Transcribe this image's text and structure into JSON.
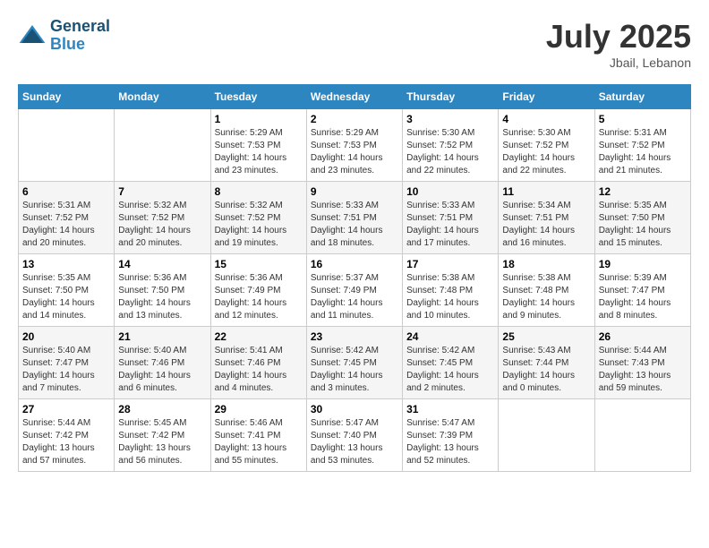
{
  "header": {
    "logo_general": "General",
    "logo_blue": "Blue",
    "month_year": "July 2025",
    "location": "Jbail, Lebanon"
  },
  "weekdays": [
    "Sunday",
    "Monday",
    "Tuesday",
    "Wednesday",
    "Thursday",
    "Friday",
    "Saturday"
  ],
  "weeks": [
    [
      {
        "day": "",
        "sunrise": "",
        "sunset": "",
        "daylight": ""
      },
      {
        "day": "",
        "sunrise": "",
        "sunset": "",
        "daylight": ""
      },
      {
        "day": "1",
        "sunrise": "Sunrise: 5:29 AM",
        "sunset": "Sunset: 7:53 PM",
        "daylight": "Daylight: 14 hours and 23 minutes."
      },
      {
        "day": "2",
        "sunrise": "Sunrise: 5:29 AM",
        "sunset": "Sunset: 7:53 PM",
        "daylight": "Daylight: 14 hours and 23 minutes."
      },
      {
        "day": "3",
        "sunrise": "Sunrise: 5:30 AM",
        "sunset": "Sunset: 7:52 PM",
        "daylight": "Daylight: 14 hours and 22 minutes."
      },
      {
        "day": "4",
        "sunrise": "Sunrise: 5:30 AM",
        "sunset": "Sunset: 7:52 PM",
        "daylight": "Daylight: 14 hours and 22 minutes."
      },
      {
        "day": "5",
        "sunrise": "Sunrise: 5:31 AM",
        "sunset": "Sunset: 7:52 PM",
        "daylight": "Daylight: 14 hours and 21 minutes."
      }
    ],
    [
      {
        "day": "6",
        "sunrise": "Sunrise: 5:31 AM",
        "sunset": "Sunset: 7:52 PM",
        "daylight": "Daylight: 14 hours and 20 minutes."
      },
      {
        "day": "7",
        "sunrise": "Sunrise: 5:32 AM",
        "sunset": "Sunset: 7:52 PM",
        "daylight": "Daylight: 14 hours and 20 minutes."
      },
      {
        "day": "8",
        "sunrise": "Sunrise: 5:32 AM",
        "sunset": "Sunset: 7:52 PM",
        "daylight": "Daylight: 14 hours and 19 minutes."
      },
      {
        "day": "9",
        "sunrise": "Sunrise: 5:33 AM",
        "sunset": "Sunset: 7:51 PM",
        "daylight": "Daylight: 14 hours and 18 minutes."
      },
      {
        "day": "10",
        "sunrise": "Sunrise: 5:33 AM",
        "sunset": "Sunset: 7:51 PM",
        "daylight": "Daylight: 14 hours and 17 minutes."
      },
      {
        "day": "11",
        "sunrise": "Sunrise: 5:34 AM",
        "sunset": "Sunset: 7:51 PM",
        "daylight": "Daylight: 14 hours and 16 minutes."
      },
      {
        "day": "12",
        "sunrise": "Sunrise: 5:35 AM",
        "sunset": "Sunset: 7:50 PM",
        "daylight": "Daylight: 14 hours and 15 minutes."
      }
    ],
    [
      {
        "day": "13",
        "sunrise": "Sunrise: 5:35 AM",
        "sunset": "Sunset: 7:50 PM",
        "daylight": "Daylight: 14 hours and 14 minutes."
      },
      {
        "day": "14",
        "sunrise": "Sunrise: 5:36 AM",
        "sunset": "Sunset: 7:50 PM",
        "daylight": "Daylight: 14 hours and 13 minutes."
      },
      {
        "day": "15",
        "sunrise": "Sunrise: 5:36 AM",
        "sunset": "Sunset: 7:49 PM",
        "daylight": "Daylight: 14 hours and 12 minutes."
      },
      {
        "day": "16",
        "sunrise": "Sunrise: 5:37 AM",
        "sunset": "Sunset: 7:49 PM",
        "daylight": "Daylight: 14 hours and 11 minutes."
      },
      {
        "day": "17",
        "sunrise": "Sunrise: 5:38 AM",
        "sunset": "Sunset: 7:48 PM",
        "daylight": "Daylight: 14 hours and 10 minutes."
      },
      {
        "day": "18",
        "sunrise": "Sunrise: 5:38 AM",
        "sunset": "Sunset: 7:48 PM",
        "daylight": "Daylight: 14 hours and 9 minutes."
      },
      {
        "day": "19",
        "sunrise": "Sunrise: 5:39 AM",
        "sunset": "Sunset: 7:47 PM",
        "daylight": "Daylight: 14 hours and 8 minutes."
      }
    ],
    [
      {
        "day": "20",
        "sunrise": "Sunrise: 5:40 AM",
        "sunset": "Sunset: 7:47 PM",
        "daylight": "Daylight: 14 hours and 7 minutes."
      },
      {
        "day": "21",
        "sunrise": "Sunrise: 5:40 AM",
        "sunset": "Sunset: 7:46 PM",
        "daylight": "Daylight: 14 hours and 6 minutes."
      },
      {
        "day": "22",
        "sunrise": "Sunrise: 5:41 AM",
        "sunset": "Sunset: 7:46 PM",
        "daylight": "Daylight: 14 hours and 4 minutes."
      },
      {
        "day": "23",
        "sunrise": "Sunrise: 5:42 AM",
        "sunset": "Sunset: 7:45 PM",
        "daylight": "Daylight: 14 hours and 3 minutes."
      },
      {
        "day": "24",
        "sunrise": "Sunrise: 5:42 AM",
        "sunset": "Sunset: 7:45 PM",
        "daylight": "Daylight: 14 hours and 2 minutes."
      },
      {
        "day": "25",
        "sunrise": "Sunrise: 5:43 AM",
        "sunset": "Sunset: 7:44 PM",
        "daylight": "Daylight: 14 hours and 0 minutes."
      },
      {
        "day": "26",
        "sunrise": "Sunrise: 5:44 AM",
        "sunset": "Sunset: 7:43 PM",
        "daylight": "Daylight: 13 hours and 59 minutes."
      }
    ],
    [
      {
        "day": "27",
        "sunrise": "Sunrise: 5:44 AM",
        "sunset": "Sunset: 7:42 PM",
        "daylight": "Daylight: 13 hours and 57 minutes."
      },
      {
        "day": "28",
        "sunrise": "Sunrise: 5:45 AM",
        "sunset": "Sunset: 7:42 PM",
        "daylight": "Daylight: 13 hours and 56 minutes."
      },
      {
        "day": "29",
        "sunrise": "Sunrise: 5:46 AM",
        "sunset": "Sunset: 7:41 PM",
        "daylight": "Daylight: 13 hours and 55 minutes."
      },
      {
        "day": "30",
        "sunrise": "Sunrise: 5:47 AM",
        "sunset": "Sunset: 7:40 PM",
        "daylight": "Daylight: 13 hours and 53 minutes."
      },
      {
        "day": "31",
        "sunrise": "Sunrise: 5:47 AM",
        "sunset": "Sunset: 7:39 PM",
        "daylight": "Daylight: 13 hours and 52 minutes."
      },
      {
        "day": "",
        "sunrise": "",
        "sunset": "",
        "daylight": ""
      },
      {
        "day": "",
        "sunrise": "",
        "sunset": "",
        "daylight": ""
      }
    ]
  ]
}
